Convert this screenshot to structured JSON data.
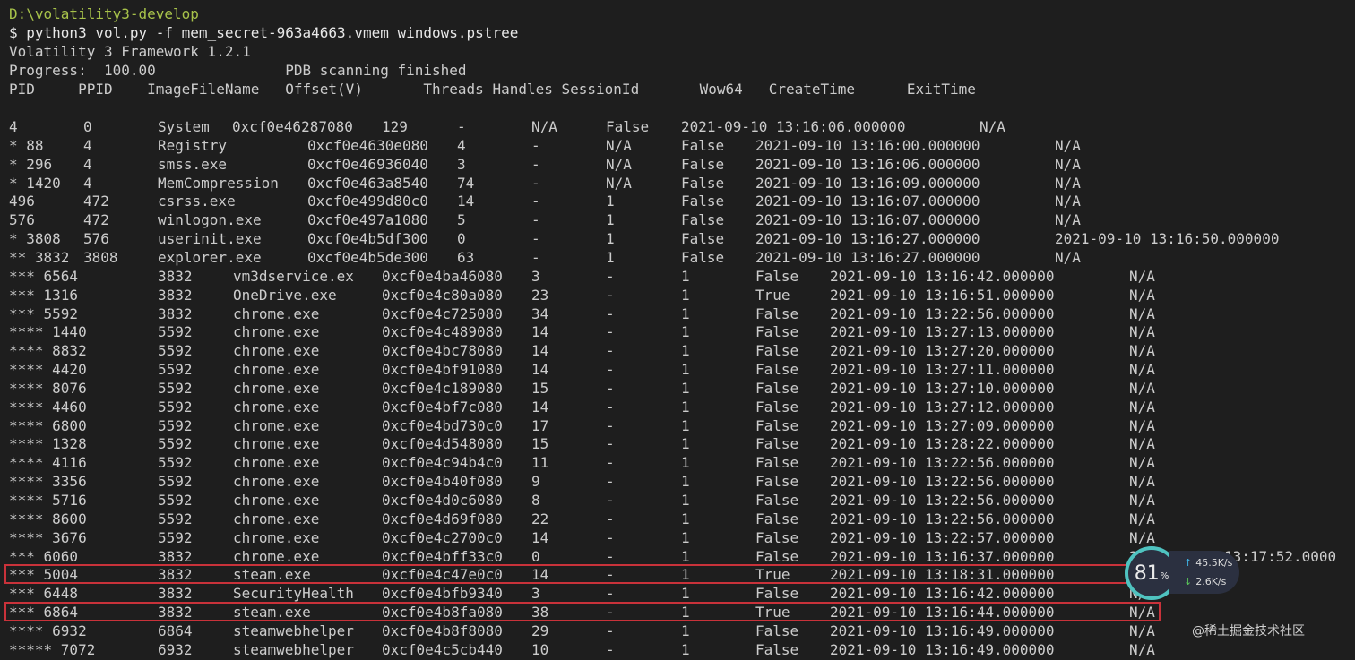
{
  "terminal": {
    "path": "D:\\volatility3-develop",
    "command": "$ python3 vol.py -f mem_secret-963a4663.vmem windows.pstree",
    "banner": "Volatility 3 Framework 1.2.1",
    "progress": "Progress:  100.00               PDB scanning finished",
    "header": "PID     PPID    ImageFileName   Offset(V)       Threads Handles SessionId       Wow64   CreateTime      ExitTime"
  },
  "rows": [
    [
      "4",
      "0",
      "System",
      "0xcf0e46287080",
      "129",
      "-",
      "N/A",
      "False",
      "2021-09-10 13:16:06.000000",
      "N/A"
    ],
    [
      "* 88",
      "4",
      "Registry",
      "0xcf0e4630e080",
      "4",
      "-",
      "N/A",
      "False",
      "2021-09-10 13:16:00.000000",
      "N/A"
    ],
    [
      "* 296",
      "4",
      "smss.exe",
      "0xcf0e46936040",
      "3",
      "-",
      "N/A",
      "False",
      "2021-09-10 13:16:06.000000",
      "N/A"
    ],
    [
      "* 1420",
      "4",
      "MemCompression",
      "0xcf0e463a8540",
      "74",
      "-",
      "N/A",
      "False",
      "2021-09-10 13:16:09.000000",
      "N/A"
    ],
    [
      "496",
      "472",
      "csrss.exe",
      "0xcf0e499d80c0",
      "14",
      "-",
      "1",
      "False",
      "2021-09-10 13:16:07.000000",
      "N/A"
    ],
    [
      "576",
      "472",
      "winlogon.exe",
      "0xcf0e497a1080",
      "5",
      "-",
      "1",
      "False",
      "2021-09-10 13:16:07.000000",
      "N/A"
    ],
    [
      "* 3808",
      "576",
      "userinit.exe",
      "0xcf0e4b5df300",
      "0",
      "-",
      "1",
      "False",
      "2021-09-10 13:16:27.000000",
      "2021-09-10 13:16:50.000000"
    ],
    [
      "** 3832",
      "3808",
      "explorer.exe",
      "0xcf0e4b5de300",
      "63",
      "-",
      "1",
      "False",
      "2021-09-10 13:16:27.000000",
      "N/A"
    ],
    [
      "*** 6564",
      "3832",
      "vm3dservice.ex",
      "0xcf0e4ba46080",
      "3",
      "-",
      "1",
      "False",
      "2021-09-10 13:16:42.000000",
      "N/A"
    ],
    [
      "*** 1316",
      "3832",
      "OneDrive.exe",
      "0xcf0e4c80a080",
      "23",
      "-",
      "1",
      "True",
      "2021-09-10 13:16:51.000000",
      "N/A"
    ],
    [
      "*** 5592",
      "3832",
      "chrome.exe",
      "0xcf0e4c725080",
      "34",
      "-",
      "1",
      "False",
      "2021-09-10 13:22:56.000000",
      "N/A"
    ],
    [
      "**** 1440",
      "5592",
      "chrome.exe",
      "0xcf0e4c489080",
      "14",
      "-",
      "1",
      "False",
      "2021-09-10 13:27:13.000000",
      "N/A"
    ],
    [
      "**** 8832",
      "5592",
      "chrome.exe",
      "0xcf0e4bc78080",
      "14",
      "-",
      "1",
      "False",
      "2021-09-10 13:27:20.000000",
      "N/A"
    ],
    [
      "**** 4420",
      "5592",
      "chrome.exe",
      "0xcf0e4bf91080",
      "14",
      "-",
      "1",
      "False",
      "2021-09-10 13:27:11.000000",
      "N/A"
    ],
    [
      "**** 8076",
      "5592",
      "chrome.exe",
      "0xcf0e4c189080",
      "15",
      "-",
      "1",
      "False",
      "2021-09-10 13:27:10.000000",
      "N/A"
    ],
    [
      "**** 4460",
      "5592",
      "chrome.exe",
      "0xcf0e4bf7c080",
      "14",
      "-",
      "1",
      "False",
      "2021-09-10 13:27:12.000000",
      "N/A"
    ],
    [
      "**** 6800",
      "5592",
      "chrome.exe",
      "0xcf0e4bd730c0",
      "17",
      "-",
      "1",
      "False",
      "2021-09-10 13:27:09.000000",
      "N/A"
    ],
    [
      "**** 1328",
      "5592",
      "chrome.exe",
      "0xcf0e4d548080",
      "15",
      "-",
      "1",
      "False",
      "2021-09-10 13:28:22.000000",
      "N/A"
    ],
    [
      "**** 4116",
      "5592",
      "chrome.exe",
      "0xcf0e4c94b4c0",
      "11",
      "-",
      "1",
      "False",
      "2021-09-10 13:22:56.000000",
      "N/A"
    ],
    [
      "**** 3356",
      "5592",
      "chrome.exe",
      "0xcf0e4b40f080",
      "9",
      "-",
      "1",
      "False",
      "2021-09-10 13:22:56.000000",
      "N/A"
    ],
    [
      "**** 5716",
      "5592",
      "chrome.exe",
      "0xcf0e4d0c6080",
      "8",
      "-",
      "1",
      "False",
      "2021-09-10 13:22:56.000000",
      "N/A"
    ],
    [
      "**** 8600",
      "5592",
      "chrome.exe",
      "0xcf0e4d69f080",
      "22",
      "-",
      "1",
      "False",
      "2021-09-10 13:22:56.000000",
      "N/A"
    ],
    [
      "**** 3676",
      "5592",
      "chrome.exe",
      "0xcf0e4c2700c0",
      "14",
      "-",
      "1",
      "False",
      "2021-09-10 13:22:57.000000",
      "N/A"
    ],
    [
      "*** 6060",
      "3832",
      "chrome.exe",
      "0xcf0e4bff33c0",
      "0",
      "-",
      "1",
      "False",
      "2021-09-10 13:16:37.000000",
      "2021-09-10 13:17:52.0000"
    ],
    [
      "*** 5004",
      "3832",
      "steam.exe",
      "0xcf0e4c47e0c0",
      "14",
      "-",
      "1",
      "True",
      "2021-09-10 13:18:31.000000",
      "N/A"
    ],
    [
      "*** 6448",
      "3832",
      "SecurityHealth",
      "0xcf0e4bfb9340",
      "3",
      "-",
      "1",
      "False",
      "2021-09-10 13:16:42.000000",
      "N/A"
    ],
    [
      "*** 6864",
      "3832",
      "steam.exe",
      "0xcf0e4b8fa080",
      "38",
      "-",
      "1",
      "True",
      "2021-09-10 13:16:44.000000",
      "N/A"
    ],
    [
      "**** 6932",
      "6864",
      "steamwebhelper",
      "0xcf0e4b8f8080",
      "29",
      "-",
      "1",
      "False",
      "2021-09-10 13:16:49.000000",
      "N/A"
    ],
    [
      "***** 7072",
      "6932",
      "steamwebhelper",
      "0xcf0e4c5cb440",
      "10",
      "-",
      "1",
      "False",
      "2021-09-10 13:16:49.000000",
      "N/A"
    ]
  ],
  "highlighted_pids": [
    "*** 5004",
    "*** 6864"
  ],
  "overlay": {
    "gauge_value": "81",
    "gauge_unit": "%",
    "upload": "45.5",
    "download": "2.6",
    "rate_unit": "K/s",
    "watermark": "@稀土掘金技术社区"
  },
  "colors": {
    "background": "#1e1e1e",
    "text": "#cccccc",
    "path": "#a7c24a",
    "highlight": "#c9323a",
    "gauge_ring": "#4fc3c0"
  }
}
